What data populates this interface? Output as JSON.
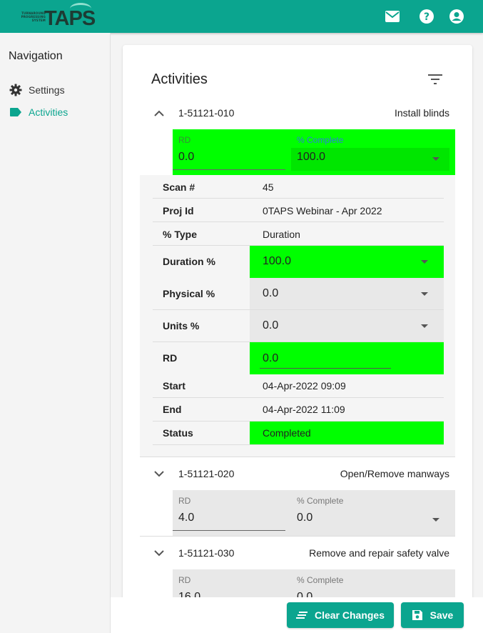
{
  "header": {
    "logo_text": "TAPS",
    "logo_subtext": "TURNAROUND PROGRESSING SYSTEM",
    "icons": [
      "mail-icon",
      "help-icon",
      "account-icon"
    ]
  },
  "sidebar": {
    "title": "Navigation",
    "items": [
      {
        "label": "Settings",
        "icon": "gear-icon",
        "active": false
      },
      {
        "label": "Activities",
        "icon": "label-tag-icon",
        "active": true
      }
    ]
  },
  "main": {
    "title": "Activities",
    "activities": [
      {
        "id": "1-51121-010",
        "name": "Install blinds",
        "expanded": true,
        "rd_label": "RD",
        "rd_value": "0.0",
        "pc_label": "% Complete",
        "pc_value": "100.0",
        "details": {
          "scan_label": "Scan #",
          "scan_value": "45",
          "projid_label": "Proj Id",
          "projid_value": "0TAPS Webinar - Apr 2022",
          "type_label": "% Type",
          "type_value": "Duration",
          "duration_label": "Duration %",
          "duration_value": "100.0",
          "physical_label": "Physical %",
          "physical_value": "0.0",
          "units_label": "Units %",
          "units_value": "0.0",
          "rd_label": "RD",
          "rd_value": "0.0",
          "start_label": "Start",
          "start_value": "04-Apr-2022 09:09",
          "end_label": "End",
          "end_value": "04-Apr-2022 11:09",
          "status_label": "Status",
          "status_value": "Completed"
        }
      },
      {
        "id": "1-51121-020",
        "name": "Open/Remove manways",
        "expanded": false,
        "rd_label": "RD",
        "rd_value": "4.0",
        "pc_label": "% Complete",
        "pc_value": "0.0"
      },
      {
        "id": "1-51121-030",
        "name": "Remove and repair safety valve",
        "expanded": false,
        "rd_label": "RD",
        "rd_value": "16.0",
        "pc_label": "% Complete",
        "pc_value": "0.0"
      }
    ]
  },
  "footer": {
    "clear_label": "Clear Changes",
    "save_label": "Save"
  },
  "colors": {
    "brand": "#0ba58f",
    "highlight": "#00ff00"
  }
}
